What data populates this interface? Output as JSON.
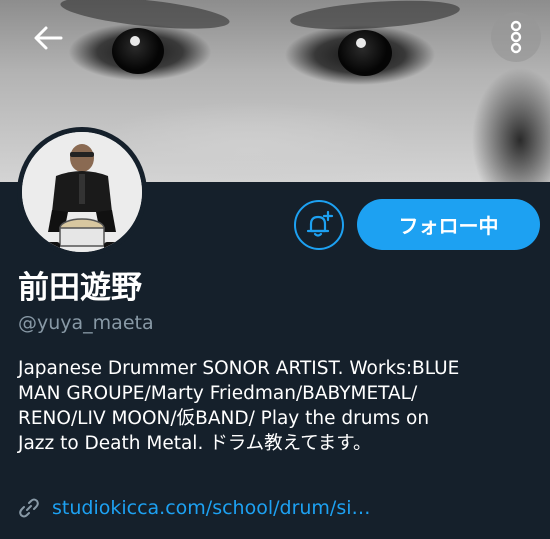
{
  "header": {
    "back_icon": "arrow-left-icon",
    "more_icon": "vertical-dots-icon"
  },
  "profile": {
    "display_name": "前田遊野",
    "handle": "@yuya_maeta",
    "bio_lines": [
      "Japanese Drummer SONOR ARTIST. Works:BLUE",
      "MAN GROUPE/Marty Friedman/BABYMETAL/",
      "RENO/LIV MOON/仮BAND/ Play the drums on",
      "Jazz to Death Metal. ドラム教えてます。"
    ],
    "link": "studiokicca.com/school/drum/si…"
  },
  "actions": {
    "follow_label": "フォロー中",
    "notify_icon": "bell-plus-icon"
  },
  "colors": {
    "background": "#15202b",
    "accent": "#1da1f2",
    "secondary_text": "#8899a6"
  }
}
